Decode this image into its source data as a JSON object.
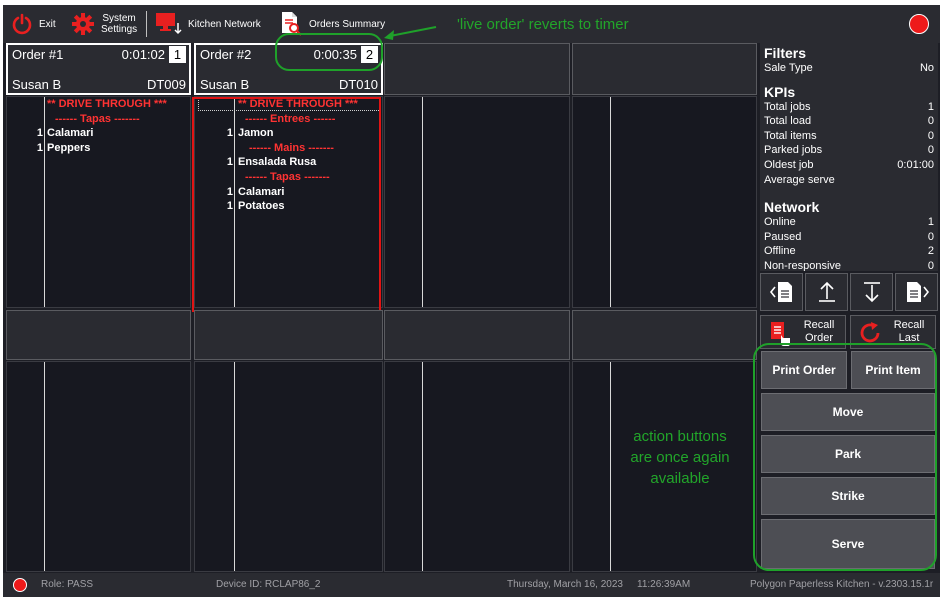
{
  "toolbar": {
    "exit_label": "Exit",
    "system_settings_label_line1": "System",
    "system_settings_label_line2": "Settings",
    "kitchen_network_label": "Kitchen Network",
    "orders_summary_label": "Orders Summary",
    "status_color": "#ee1a1a"
  },
  "orders": [
    {
      "title": "Order #1",
      "timer": "0:01:02",
      "number": "1",
      "customer": "Susan B",
      "code": "DT009",
      "lines": [
        {
          "qty": "",
          "text": "** DRIVE THROUGH ***",
          "kind": "red"
        },
        {
          "qty": "",
          "text": "------ Tapas -------",
          "kind": "sec"
        },
        {
          "qty": "1",
          "text": "Calamari",
          "kind": "item"
        },
        {
          "qty": "1",
          "text": "Peppers",
          "kind": "item"
        }
      ]
    },
    {
      "title": "Order #2",
      "timer": "0:00:35",
      "number": "2",
      "customer": "Susan B",
      "code": "DT010",
      "lines": [
        {
          "qty": "",
          "text": "** DRIVE THROUGH ***",
          "kind": "red"
        },
        {
          "qty": "",
          "text": "------ Entrees ------",
          "kind": "sec"
        },
        {
          "qty": "1",
          "text": "Jamon",
          "kind": "item"
        },
        {
          "qty": "",
          "text": "------ Mains -------",
          "kind": "sec"
        },
        {
          "qty": "1",
          "text": "Ensalada Rusa",
          "kind": "item"
        },
        {
          "qty": "",
          "text": "------ Tapas -------",
          "kind": "sec"
        },
        {
          "qty": "1",
          "text": "Calamari",
          "kind": "item"
        },
        {
          "qty": "1",
          "text": "Potatoes",
          "kind": "item"
        }
      ]
    }
  ],
  "panel": {
    "filters_title": "Filters",
    "sale_type_label": "Sale Type",
    "sale_type_value": "No",
    "kpis_title": "KPIs",
    "kpis": [
      {
        "label": "Total jobs",
        "value": "1"
      },
      {
        "label": "Total load",
        "value": "0"
      },
      {
        "label": "Total items",
        "value": "0"
      },
      {
        "label": "Parked jobs",
        "value": "0"
      },
      {
        "label": "Oldest job",
        "value": "0:01:00"
      },
      {
        "label": "Average serve",
        "value": ""
      }
    ],
    "network_title": "Network",
    "network": [
      {
        "label": "Online",
        "value": "1"
      },
      {
        "label": "Paused",
        "value": "0"
      },
      {
        "label": "Offline",
        "value": "2"
      },
      {
        "label": "Non-responsive",
        "value": "0"
      }
    ]
  },
  "recall": {
    "order_line1": "Recall",
    "order_line2": "Order",
    "last_line1": "Recall",
    "last_line2": "Last"
  },
  "actions": {
    "print_order": "Print Order",
    "print_item": "Print Item",
    "move": "Move",
    "park": "Park",
    "strike": "Strike",
    "serve": "Serve"
  },
  "annotations": {
    "live_order": "'live order' reverts to timer",
    "action_line1": "action buttons",
    "action_line2": "are once again",
    "action_line3": "available",
    "color": "#22a52a"
  },
  "statusbar": {
    "role": "Role: PASS",
    "device": "Device ID: RCLAP86_2",
    "date": "Thursday, March 16, 2023",
    "time": "11:26:39AM",
    "version": "Polygon Paperless Kitchen - v.2303.15.1r"
  }
}
